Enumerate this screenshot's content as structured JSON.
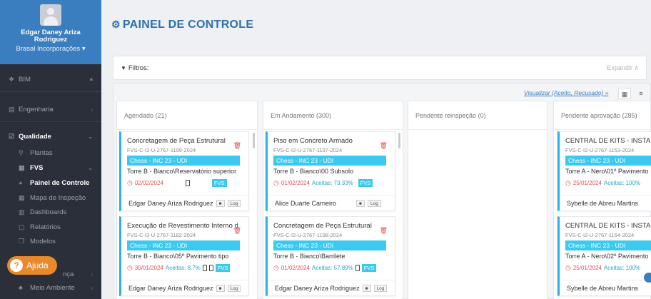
{
  "sidebar": {
    "user_name": "Edgar Daney Ariza Rodriguez",
    "company": "Brasal Incorporações ▾",
    "items": [
      {
        "label": "BIM",
        "icon": "cubes-icon"
      },
      {
        "label": "Engenharia",
        "icon": "building-icon"
      },
      {
        "label": "Qualidade",
        "icon": "check-square-icon"
      },
      {
        "label": "Plantas",
        "icon": "map-marker-icon"
      },
      {
        "label": "FVS",
        "icon": "file-icon"
      },
      {
        "label": "Painel de Controle",
        "icon": "dashboard-icon"
      },
      {
        "label": "Mapa de Inspeção",
        "icon": "grid-icon"
      },
      {
        "label": "Dashboards",
        "icon": "bar-chart-icon"
      },
      {
        "label": "Relatórios",
        "icon": "report-icon"
      },
      {
        "label": "Modelos",
        "icon": "copy-icon"
      },
      {
        "label": "nça",
        "icon": "shield-icon"
      },
      {
        "label": "Meio Ambiente",
        "icon": "leaf-icon"
      }
    ],
    "help_label": "Ajuda"
  },
  "header": {
    "title": "PAINEL DE CONTROLE"
  },
  "filters": {
    "label": "Filtros:",
    "expand": "Expandir ∧"
  },
  "board": {
    "view_link": "Visualizar (Aceito, Recusado) »",
    "columns": [
      {
        "title": "Agendado (21)"
      },
      {
        "title": "Em Andamento (300)"
      },
      {
        "title": "Pendente reinspeção (0)"
      },
      {
        "title": "Pendente aprovação (285)"
      }
    ],
    "cards": [
      {
        "title": "Concretagem de Peça Estrutural",
        "code": "FVS-C-I2-U-2767-1199-2024",
        "tag": "Chess - INC 23 - UDI",
        "location": "Torre B - Bianco\\Reservatório superior",
        "date": "02/02/2024",
        "accepted": "",
        "fvs": "FVS",
        "user": "Edgar Daney Ariza Rodriguez",
        "log": "Log"
      },
      {
        "title": "Execução de Revestimento Interno de",
        "code": "FVS-C-I2-U-2767-1182-2024",
        "tag": "Chess - INC 23 - UDI",
        "location": "Torre B - Bianco\\05º Pavimento tipo",
        "date": "30/01/2024",
        "accepted": "Aceitas: 8.7%",
        "fvs": "FVS",
        "user": "Edgar Daney Ariza Rodriguez",
        "log": "Log"
      },
      {
        "title": "Piso em Concreto Armado",
        "code": "FVS-C-I2-U-2767-1197-2024",
        "tag": "Chess - INC 23 - UDI",
        "location": "Torre B - Bianco\\00 Subsolo",
        "date": "01/02/2024",
        "accepted": "Aceitas: 73.33%",
        "fvs": "FVS",
        "user": "Alice Duarte Carneiro",
        "log": "Log"
      },
      {
        "title": "Concretagem de Peça Estrutural",
        "code": "FVS-C-I2-U-2767-1198-2024",
        "tag": "Chess - INC 23 - UDI",
        "location": "Torre B - Bianco\\Barrilete",
        "date": "01/02/2024",
        "accepted": "Aceitas: 57.89%",
        "fvs": "FVS",
        "user": "Edgar Daney Ariza Rodriguez",
        "log": "Log"
      },
      {
        "title": "CENTRAL DE KITS - INSTALAÇÕ",
        "code": "FVS-C-I2-U-2767-1153-2024",
        "tag": "Chess - INC 23 - UDI",
        "location": "Torre A - Nero\\01º Pavimento",
        "date": "25/01/2024",
        "accepted": "Aceitas: 100%",
        "fvs": "",
        "user": "Sybelle de Abreu Martins",
        "log": ""
      },
      {
        "title": "CENTRAL DE KITS - INSTALAÇÕ",
        "code": "FVS-C-I2-U-2767-1154-2024",
        "tag": "Chess - INC 23 - UDI",
        "location": "Torre A - Nero\\02º Pavimento",
        "date": "25/01/2024",
        "accepted": "Aceitas: 100%",
        "fvs": "",
        "user": "Sybelle de Abreu Martins",
        "log": ""
      }
    ]
  },
  "colors": {
    "accent": "#3a7ebf",
    "tag": "#3cc9ef",
    "sidebar": "#2b2f3a",
    "help": "#e8892b"
  }
}
